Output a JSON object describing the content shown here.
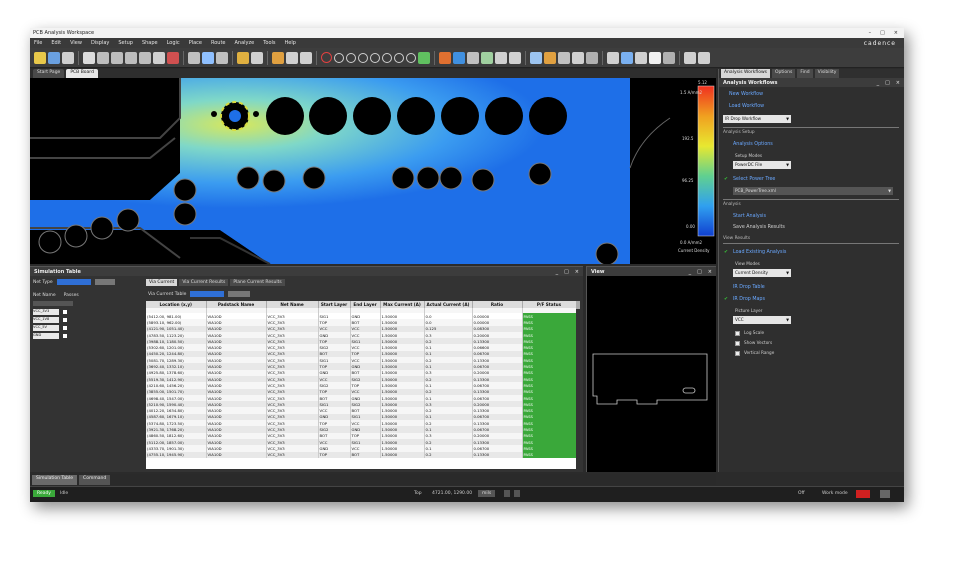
{
  "window": {
    "title": "PCB Analysis Workspace",
    "controls": [
      "–",
      "□",
      "×"
    ]
  },
  "menu": {
    "items": [
      "File",
      "Edit",
      "View",
      "Display",
      "Setup",
      "Shape",
      "Logic",
      "Place",
      "Route",
      "Analyze",
      "Tools",
      "Help"
    ],
    "brand": "cadence"
  },
  "doc_tabs": [
    "Start Page",
    "PCB Board"
  ],
  "canvas": {
    "legend_ticks": [
      "5.12",
      "1.5 A/mm2",
      "192.5",
      "96.25",
      "0.00",
      "0.0 A/mm2"
    ],
    "legend_caption": "Current Density"
  },
  "sim_table": {
    "title": "Simulation Table",
    "controls": [
      "_",
      "□",
      "×"
    ],
    "filters": {
      "net_label": "Net Type",
      "net_name_label": "Net Name",
      "pass_label": "Passes",
      "net_rows": [
        "VCC_3V3",
        "VCC_1V8",
        "VCC_5V",
        "GND"
      ]
    },
    "tabs": [
      "Via Current",
      "Via Current Results",
      "Plane Current Results"
    ],
    "filter_label": "Via Current Table",
    "columns": [
      "Location (x,y)",
      "Padstack Name",
      "Net Name",
      "Start Layer",
      "End Layer",
      "Max Current (A)",
      "Actual Current (A)",
      "Ratio",
      "P/F Status"
    ],
    "rows": [
      [
        "(5412.00, 981.00)",
        "VIA10D",
        "VCC_3V3",
        "SIG1",
        "GND",
        "1.50000",
        "0.0",
        "0.00000",
        "PASS"
      ],
      [
        "(5893.10, 962.00)",
        "VIA10D",
        "VCC_3V3",
        "TOP",
        "BOT",
        "1.50000",
        "0.0",
        "0.00000",
        "PASS"
      ],
      [
        "(4121.90, 1051.40)",
        "VIA10D",
        "VCC_3V3",
        "VCC",
        "VCC",
        "1.50000",
        "0.125",
        "0.08300",
        "PASS"
      ],
      [
        "(4783.50, 1123.20)",
        "VIA10D",
        "VCC_3V3",
        "GND",
        "VCC",
        "1.50000",
        "0.3",
        "0.20000",
        "PASS"
      ],
      [
        "(3988.10, 1180.50)",
        "VIA10D",
        "VCC_3V3",
        "TOP",
        "SIG1",
        "1.50000",
        "0.2",
        "0.13300",
        "PASS"
      ],
      [
        "(5302.60, 1201.00)",
        "VIA10D",
        "VCC_3V3",
        "SIG2",
        "VCC",
        "1.50000",
        "0.1",
        "0.06600",
        "PASS"
      ],
      [
        "(4450.20, 1244.80)",
        "VIA10D",
        "VCC_3V3",
        "BOT",
        "TOP",
        "1.50000",
        "0.1",
        "0.06700",
        "PASS"
      ],
      [
        "(5081.70, 1289.30)",
        "VIA10D",
        "VCC_3V3",
        "SIG1",
        "VCC",
        "1.50000",
        "0.2",
        "0.13300",
        "PASS"
      ],
      [
        "(3692.40, 1332.10)",
        "VIA10D",
        "VCC_3V3",
        "TOP",
        "GND",
        "1.50000",
        "0.1",
        "0.06700",
        "PASS"
      ],
      [
        "(4925.80, 1378.60)",
        "VIA10D",
        "VCC_3V3",
        "GND",
        "BOT",
        "1.50000",
        "0.3",
        "0.20000",
        "PASS"
      ],
      [
        "(5519.30, 1412.90)",
        "VIA10D",
        "VCC_3V3",
        "VCC",
        "SIG2",
        "1.50000",
        "0.2",
        "0.13300",
        "PASS"
      ],
      [
        "(4210.60, 1456.20)",
        "VIA10D",
        "VCC_3V3",
        "SIG2",
        "TOP",
        "1.50000",
        "0.1",
        "0.06700",
        "PASS"
      ],
      [
        "(3855.00, 1501.70)",
        "VIA10D",
        "VCC_3V3",
        "TOP",
        "VCC",
        "1.50000",
        "0.2",
        "0.13300",
        "PASS"
      ],
      [
        "(4698.40, 1547.00)",
        "VIA10D",
        "VCC_3V3",
        "BOT",
        "GND",
        "1.50000",
        "0.1",
        "0.06700",
        "PASS"
      ],
      [
        "(5210.90, 1590.40)",
        "VIA10D",
        "VCC_3V3",
        "SIG1",
        "SIG2",
        "1.50000",
        "0.3",
        "0.20000",
        "PASS"
      ],
      [
        "(4012.20, 1634.80)",
        "VIA10D",
        "VCC_3V3",
        "VCC",
        "BOT",
        "1.50000",
        "0.2",
        "0.13300",
        "PASS"
      ],
      [
        "(4587.60, 1679.10)",
        "VIA10D",
        "VCC_3V3",
        "GND",
        "SIG1",
        "1.50000",
        "0.1",
        "0.06700",
        "PASS"
      ],
      [
        "(5374.80, 1723.50)",
        "VIA10D",
        "VCC_3V3",
        "TOP",
        "VCC",
        "1.50000",
        "0.2",
        "0.13300",
        "PASS"
      ],
      [
        "(3921.30, 1768.20)",
        "VIA10D",
        "VCC_3V3",
        "SIG2",
        "GND",
        "1.50000",
        "0.1",
        "0.06700",
        "PASS"
      ],
      [
        "(4860.50, 1812.60)",
        "VIA10D",
        "VCC_3V3",
        "BOT",
        "TOP",
        "1.50000",
        "0.3",
        "0.20000",
        "PASS"
      ],
      [
        "(5112.00, 1857.00)",
        "VIA10D",
        "VCC_3V3",
        "VCC",
        "SIG1",
        "1.50000",
        "0.2",
        "0.13300",
        "PASS"
      ],
      [
        "(4333.70, 1901.30)",
        "VIA10D",
        "VCC_3V3",
        "GND",
        "VCC",
        "1.50000",
        "0.1",
        "0.06700",
        "PASS"
      ],
      [
        "(4755.10, 1945.90)",
        "VIA10D",
        "VCC_3V3",
        "TOP",
        "BOT",
        "1.50000",
        "0.2",
        "0.13300",
        "PASS"
      ]
    ]
  },
  "view_panel": {
    "title": "View",
    "controls": [
      "_",
      "□",
      "×"
    ]
  },
  "right_panel": {
    "tabs": [
      "Analysis Workflows",
      "Options",
      "Find",
      "Visibility"
    ],
    "title": "Analysis Workflows",
    "controls": [
      "_",
      "□",
      "×"
    ],
    "new_workflow": "New Workflow",
    "load_workflow": "Load Workflow",
    "workflow_value": "IR Drop Workflow",
    "section_setup": "Analysis Setup",
    "analysis_options": "Analysis Options",
    "setup_mode_label": "Setup Modes",
    "setup_mode_value": "PowerDC File",
    "select_power_tree": "Select Power Tree",
    "power_tree_value": "PCB_PowerTree.xml",
    "section_analysis": "Analysis",
    "start_analysis": "Start Analysis",
    "save_results": "Save Analysis Results",
    "section_view": "View Results",
    "load_existing": "Load Existing Analysis",
    "view_modes_label": "View Modes",
    "view_mode_value": "Current Density",
    "ir_drop_table": "IR Drop Table",
    "ir_drop_maps": "IR Drop Maps",
    "picture_layer_label": "Picture Layer",
    "picture_layer_value": "VCC",
    "checkboxes": [
      "Log Scale",
      "Show Vectors",
      "Vertical Range"
    ]
  },
  "bottom_tabs": [
    "Simulation Table",
    "Command"
  ],
  "status": {
    "state": "Ready",
    "mode": "Idle",
    "layer": "Top",
    "coords": "4721.00, 1290.00",
    "unit": "mils",
    "right_items": [
      "Off",
      "Work mode"
    ]
  },
  "colors": {
    "accent_blue": "#2f6fd6",
    "pass_green": "#3aa83a",
    "panel_bg": "#2f2f2f",
    "canvas_low": "#1e6fe8",
    "canvas_high": "#f0e020"
  }
}
